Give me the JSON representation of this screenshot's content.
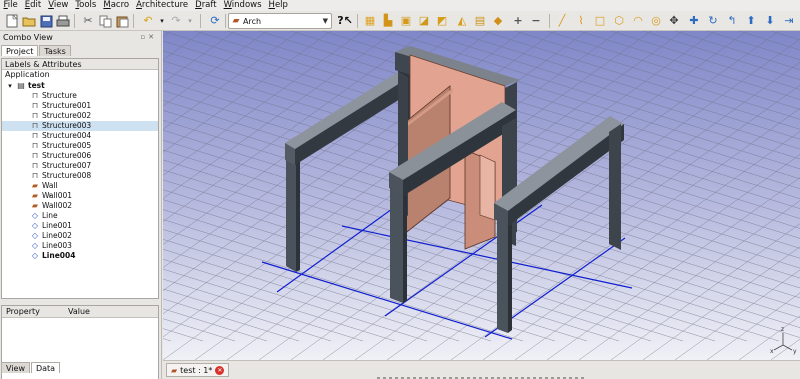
{
  "menu": [
    "File",
    "Edit",
    "View",
    "Tools",
    "Macro",
    "Architecture",
    "Draft",
    "Windows",
    "Help"
  ],
  "workbench": {
    "label": "Arch",
    "icon": "arch-workbench-icon"
  },
  "toolbar_icons": [
    "new-document-icon",
    "open-file-icon",
    "save-icon",
    "print-icon",
    "cut-icon",
    "copy-icon",
    "paste-icon",
    "undo-icon",
    "redo-icon",
    "refresh-icon",
    "whats-this-icon",
    "structure-icon",
    "wall-icon",
    "window-icon",
    "section-plane-icon",
    "axis-icon",
    "roof-icon",
    "site-icon",
    "add-icon",
    "remove-icon",
    "line-icon",
    "wire-icon",
    "rectangle-icon",
    "polygon-icon",
    "arc-icon",
    "circle-icon",
    "move-icon",
    "rotate-icon",
    "offset-icon",
    "up-arrow-icon",
    "down-arrow-icon",
    "trim-icon"
  ],
  "combo": {
    "title": "Combo View",
    "tabs": [
      "Project",
      "Tasks"
    ],
    "tree_header": "Labels & Attributes",
    "section": "Application",
    "document": "test",
    "items": [
      {
        "label": "Structure",
        "type": "struct"
      },
      {
        "label": "Structure001",
        "type": "struct"
      },
      {
        "label": "Structure002",
        "type": "struct"
      },
      {
        "label": "Structure003",
        "type": "struct",
        "selected": true
      },
      {
        "label": "Structure004",
        "type": "struct"
      },
      {
        "label": "Structure005",
        "type": "struct"
      },
      {
        "label": "Structure006",
        "type": "struct"
      },
      {
        "label": "Structure007",
        "type": "struct"
      },
      {
        "label": "Structure008",
        "type": "struct"
      },
      {
        "label": "Wall",
        "type": "wall"
      },
      {
        "label": "Wall001",
        "type": "wall",
        "expandable": true
      },
      {
        "label": "Wall002",
        "type": "wall"
      },
      {
        "label": "Line",
        "type": "line"
      },
      {
        "label": "Line001",
        "type": "line"
      },
      {
        "label": "Line002",
        "type": "line"
      },
      {
        "label": "Line003",
        "type": "line"
      },
      {
        "label": "Line004",
        "type": "line",
        "bold": true
      }
    ],
    "property_headers": [
      "Property",
      "Value"
    ],
    "bottom_tabs": [
      "View",
      "Data"
    ]
  },
  "document_tab": {
    "label": "test : 1*"
  },
  "colors": {
    "viewport_top": "#7f87c8",
    "viewport_bottom": "#f0f1f6",
    "beam": "#3e4650",
    "wall": "#e2a490",
    "axis": "#1020d0",
    "selection": "#cde1f1"
  }
}
